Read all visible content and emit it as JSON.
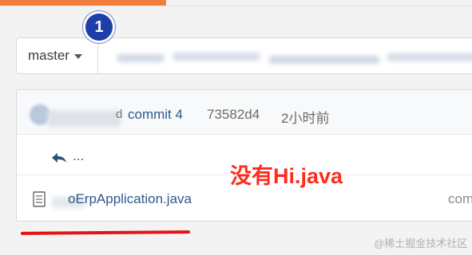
{
  "branch": {
    "label": "master"
  },
  "badge": {
    "number": "1"
  },
  "commit": {
    "name_tail": "d",
    "message": "commit 4",
    "hash": "73582d4",
    "time": "2小时前"
  },
  "parent": {
    "label": "..."
  },
  "files": [
    {
      "name": "oErpApplication.java",
      "last_commit": "com"
    }
  ],
  "annotation": {
    "text": "没有Hi.java"
  },
  "watermark": {
    "text": "@稀土掘金技术社区"
  },
  "colors": {
    "accent_orange": "#f07d3c",
    "badge_blue": "#1e3ea8",
    "annotation_red": "#ff2b1c",
    "link_blue": "#2e5a8a"
  },
  "icons": {
    "branch_caret": "caret-down-icon",
    "parent": "back-arrow-icon",
    "file": "file-text-icon"
  }
}
